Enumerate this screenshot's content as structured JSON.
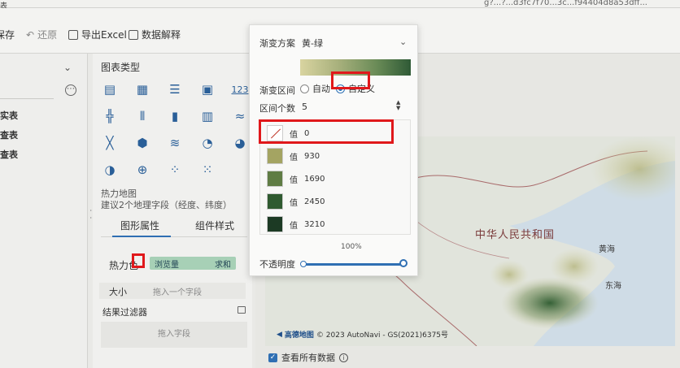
{
  "topbar": {
    "left_text": "表",
    "right_text": "g?...?...d3fc7f70...3c...f94404d8a53dff..."
  },
  "toolbar": {
    "save_label": "保存",
    "revert_label": "还原",
    "export_label": "导出Excel",
    "explain_label": "数据解释"
  },
  "left_panel": {
    "items": [
      "实表",
      "查表",
      "查表"
    ]
  },
  "chart_types": {
    "title": "图表类型",
    "icons": [
      "table-icon",
      "crosstab-icon",
      "list-table-icon",
      "card-icon",
      "number-icon",
      "bar-grid-icon",
      "grouped-bar-icon",
      "column-chart-icon",
      "stacked-column-icon",
      "wave-icon",
      "line-icon",
      "hexagon-icon",
      "area-icon",
      "gauge-icon",
      "pie-icon",
      "donut-icon",
      "globe-icon",
      "scatter-icon",
      "bubble-icon"
    ],
    "desc_line1": "热力地图",
    "desc_line2": "建议2个地理字段（经度、纬度）"
  },
  "tabs": {
    "shape": "图形属性",
    "component": "组件样式"
  },
  "heat": {
    "label": "热力色",
    "field": "浏览量",
    "agg": "求和"
  },
  "size": {
    "label": "大小",
    "placeholder": "拖入一个字段"
  },
  "filter": {
    "title": "结果过滤器",
    "placeholder": "拖入字段"
  },
  "popup": {
    "scheme_label": "渐变方案",
    "scheme_value": "黄-绿",
    "interval_label": "渐变区间",
    "interval_options": [
      "自动",
      "自定义"
    ],
    "interval_selected": "自定义",
    "count_label": "区间个数",
    "count_value": "5",
    "steps": [
      {
        "label": "值",
        "value": "0",
        "color": "none"
      },
      {
        "label": "值",
        "value": "930",
        "color": "#a4a462"
      },
      {
        "label": "值",
        "value": "1690",
        "color": "#5f7c44"
      },
      {
        "label": "值",
        "value": "2450",
        "color": "#2f5a30"
      },
      {
        "label": "值",
        "value": "3210",
        "color": "#1c3a24"
      }
    ],
    "opacity_label": "不透明度",
    "opacity_value": "100%",
    "opacity_level": 1.0
  },
  "map": {
    "country_label": "中华人民共和国",
    "sea1": "黄海",
    "sea2": "东海",
    "attribution_brand": "高德地图",
    "attribution_text": "© 2023 AutoNavi - GS(2021)6375号"
  },
  "view_all": {
    "label": "查看所有数据",
    "checked": true
  }
}
